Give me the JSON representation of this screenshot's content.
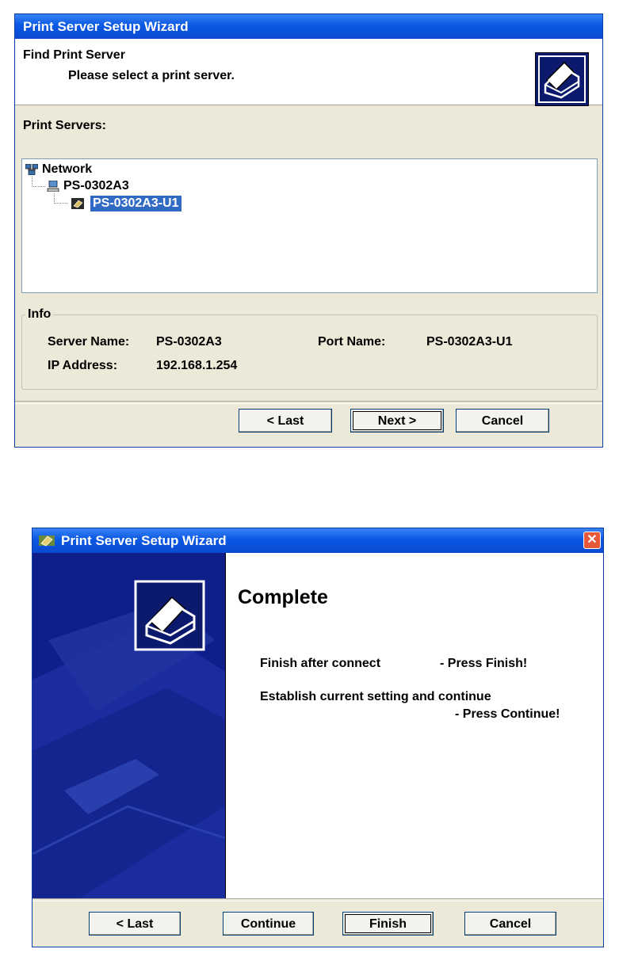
{
  "wizard1": {
    "title": "Print Server Setup Wizard",
    "header_title": "Find Print Server",
    "header_subtitle": "Please select a print server.",
    "list_label": "Print Servers:",
    "tree": {
      "root": "Network",
      "server": "PS-0302A3",
      "port": "PS-0302A3-U1"
    },
    "info": {
      "group_label": "Info",
      "server_name_label": "Server Name:",
      "server_name_value": "PS-0302A3",
      "port_name_label": "Port Name:",
      "port_name_value": "PS-0302A3-U1",
      "ip_label": "IP Address:",
      "ip_value": "192.168.1.254"
    },
    "buttons": {
      "last": "< Last",
      "next": "Next >",
      "cancel": "Cancel"
    }
  },
  "wizard2": {
    "title": "Print Server Setup Wizard",
    "heading": "Complete",
    "line1_left": "Finish after connect",
    "line1_right": "- Press Finish!",
    "line2": "Establish current setting and continue",
    "line2_right": "- Press Continue!",
    "buttons": {
      "last": "< Last",
      "continue": "Continue",
      "finish": "Finish",
      "cancel": "Cancel"
    },
    "close_glyph": "✕"
  },
  "colors": {
    "title_bar": "#0a58e4",
    "selection": "#316ac5",
    "side_panel": "#0f1e8a",
    "window_bg": "#ece9d8"
  }
}
